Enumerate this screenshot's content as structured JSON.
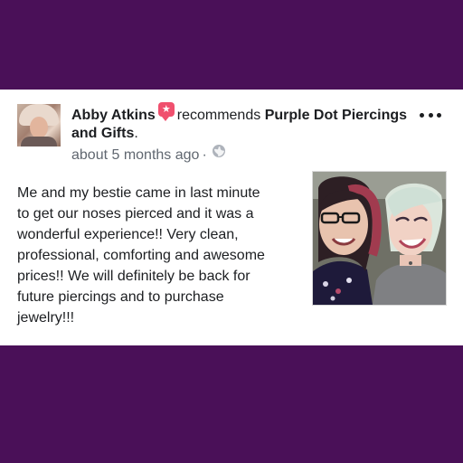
{
  "post": {
    "author_name": "Abby Atkins",
    "recommend_verb": "recommends",
    "page_name": "Purple Dot Piercings and Gifts",
    "page_name_suffix": ".",
    "timestamp": "about 5 months ago",
    "separator": "·",
    "privacy_icon": "globe-icon",
    "badge_icon": "star-icon",
    "more_icon": "more-options-icon",
    "body": "Me and my bestie came in last minute\nto get our noses pierced and it was a\nwonderful experience!! Very clean,\nprofessional, comforting and awesome\nprices!! We will definitely be back for\nfuture piercings and to purchase\njewelry!!!"
  },
  "colors": {
    "background": "#4a1058",
    "card": "#ffffff",
    "badge": "#f0506e",
    "text": "#1c1e21",
    "meta_text": "#606770"
  }
}
